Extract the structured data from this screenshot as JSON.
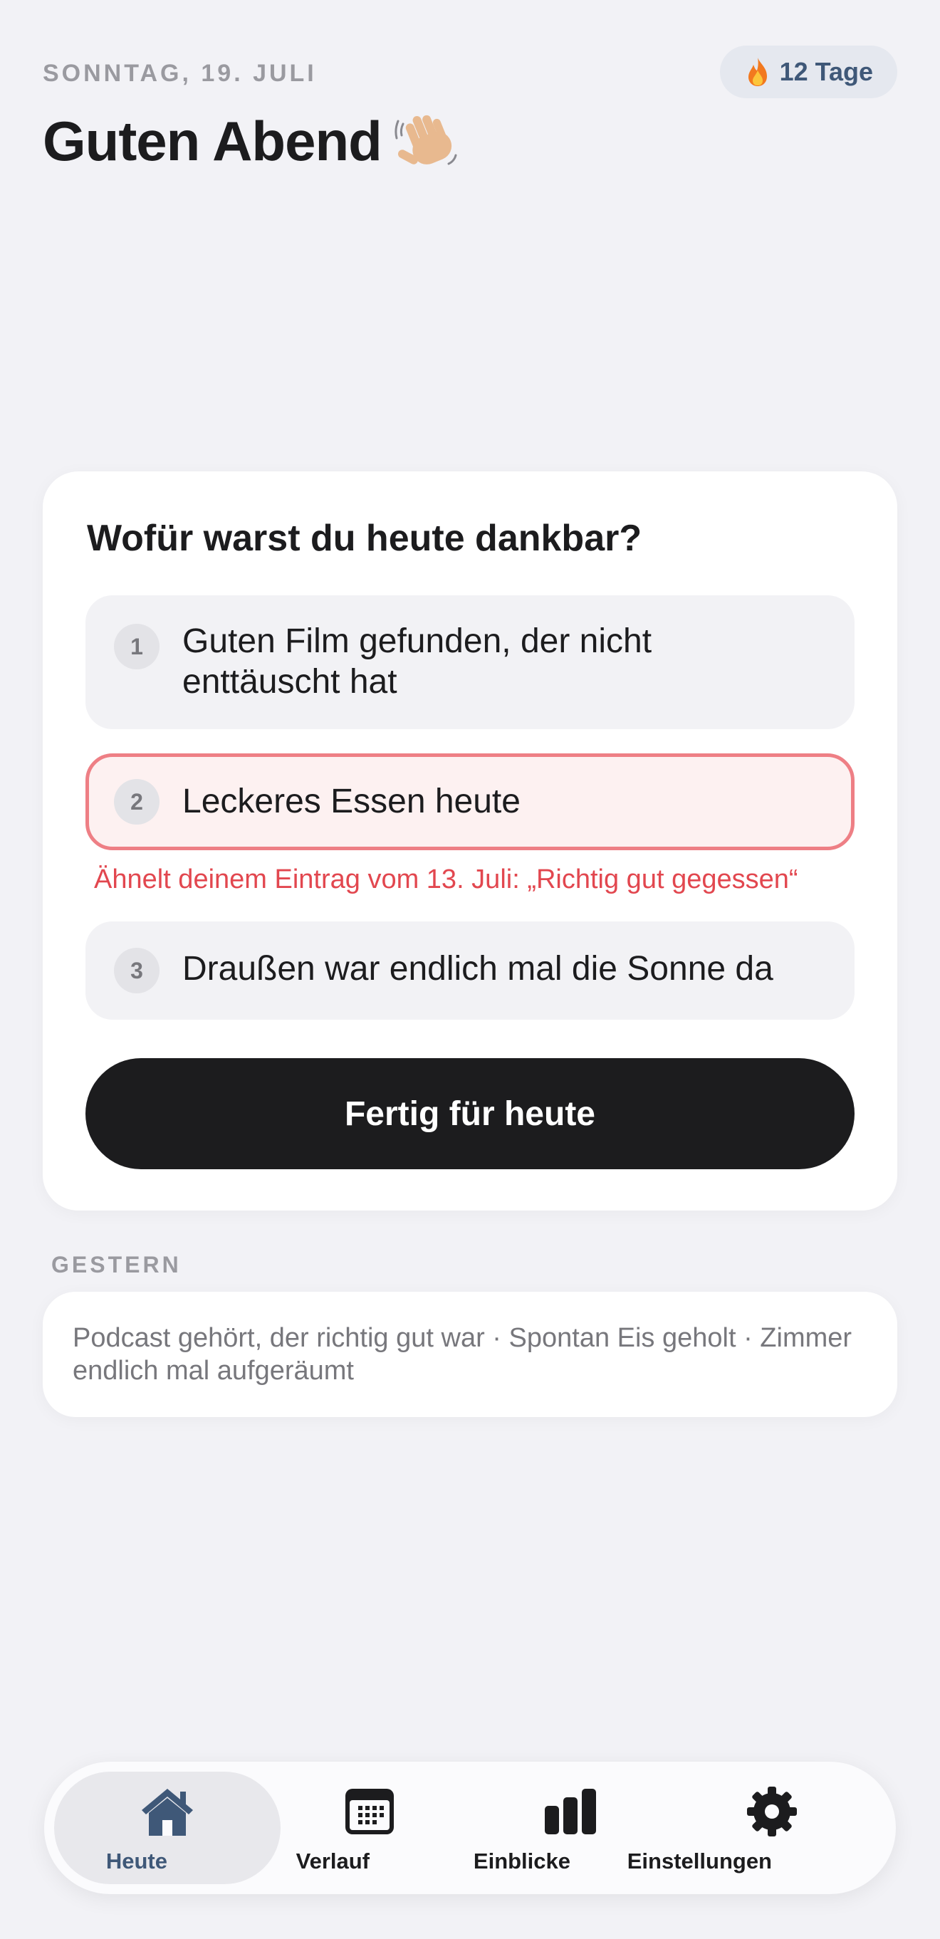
{
  "header": {
    "date": "SONNTAG, 19. JULI",
    "streak_label": "12 Tage",
    "streak_icon": "flame-icon",
    "greeting": "Guten Abend",
    "greeting_icon": "waving-hand-icon"
  },
  "card": {
    "question": "Wofür warst du heute dankbar?",
    "entries": [
      {
        "number": "1",
        "text": "Guten Film gefunden, der nicht enttäuscht hat"
      },
      {
        "number": "2",
        "text": "Leckeres Essen heute"
      },
      {
        "number": "3",
        "text": "Draußen war endlich mal die Sonne da"
      }
    ],
    "warning": "Ähnelt deinem Eintrag vom 13. Juli: „Richtig gut gegessen“",
    "done_label": "Fertig für heute"
  },
  "yesterday": {
    "label": "GESTERN",
    "summary": "Podcast gehört, der richtig gut war · Spontan Eis geholt · Zimmer endlich mal aufgeräumt"
  },
  "tabbar": {
    "tabs": [
      {
        "label": "Heute",
        "icon": "home-icon",
        "active": true
      },
      {
        "label": "Verlauf",
        "icon": "calendar-icon",
        "active": false
      },
      {
        "label": "Einblicke",
        "icon": "bar-chart-icon",
        "active": false
      },
      {
        "label": "Einstellungen",
        "icon": "gear-icon",
        "active": false
      }
    ]
  },
  "colors": {
    "accent": "#3f5878",
    "error": "#e2474f",
    "error_border": "#ee7f85",
    "button": "#1c1c1e",
    "background": "#f2f2f6"
  }
}
